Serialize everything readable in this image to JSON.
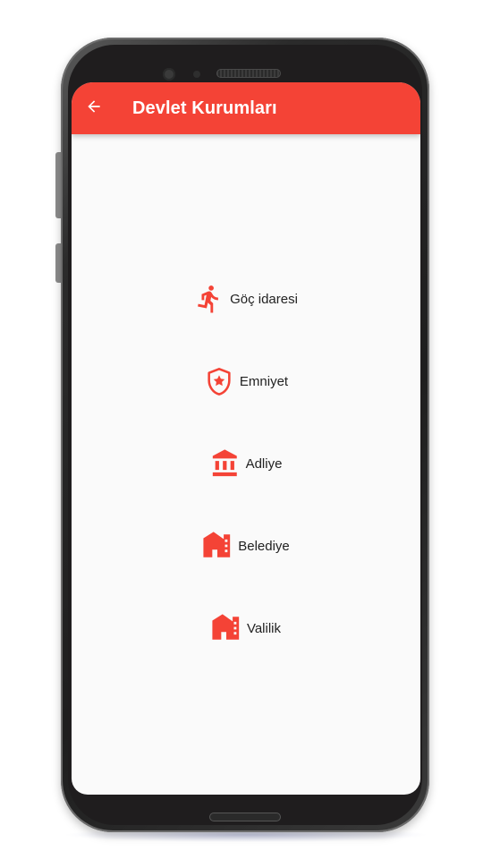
{
  "appbar": {
    "title": "Devlet Kurumları",
    "back_icon": "arrow-back-icon",
    "color": "#f44336"
  },
  "menu": {
    "items": [
      {
        "label": "Göç idaresi",
        "icon": "running-person-icon"
      },
      {
        "label": "Emniyet",
        "icon": "police-shield-icon"
      },
      {
        "label": "Adliye",
        "icon": "courthouse-icon"
      },
      {
        "label": "Belediye",
        "icon": "home-building-icon"
      },
      {
        "label": "Valilik",
        "icon": "home-building-icon"
      }
    ],
    "icon_color": "#f44336"
  }
}
